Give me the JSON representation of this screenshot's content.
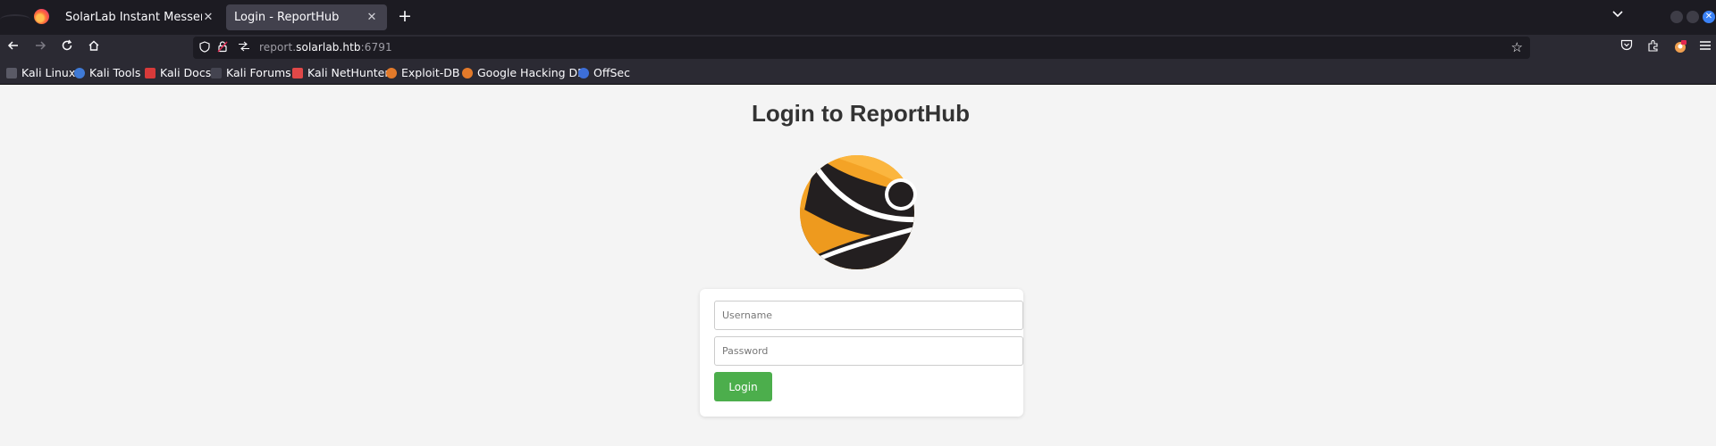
{
  "browser": {
    "tabs": [
      {
        "label": "SolarLab Instant Messenger",
        "active": false
      },
      {
        "label": "Login - ReportHub",
        "active": true
      }
    ],
    "new_tab_icon": "+",
    "url": {
      "prefix": "report.",
      "host": "solarlab.htb",
      "suffix": ":6791"
    },
    "bookmarks": [
      {
        "label": "Kali Linux",
        "icon": "kali-dragon-icon",
        "color": "#5a5a66"
      },
      {
        "label": "Kali Tools",
        "icon": "kali-tools-icon",
        "color": "#3f7ad6"
      },
      {
        "label": "Kali Docs",
        "icon": "kali-docs-icon",
        "color": "#d83a3a"
      },
      {
        "label": "Kali Forums",
        "icon": "kali-forums-icon",
        "color": "#444450"
      },
      {
        "label": "Kali NetHunter",
        "icon": "kali-nethunter-icon",
        "color": "#e04848"
      },
      {
        "label": "Exploit-DB",
        "icon": "exploit-db-icon",
        "color": "#e37a2a"
      },
      {
        "label": "Google Hacking DB",
        "icon": "ghdb-icon",
        "color": "#e37a2a"
      },
      {
        "label": "OffSec",
        "icon": "offsec-icon",
        "color": "#3d6fd8"
      }
    ]
  },
  "page": {
    "title": "Login to ReportHub",
    "username_placeholder": "Username",
    "password_placeholder": "Password",
    "login_label": "Login",
    "colors": {
      "accent": "#4cae4c",
      "logo_orange": "#f4a326",
      "logo_dark": "#231f20"
    }
  }
}
